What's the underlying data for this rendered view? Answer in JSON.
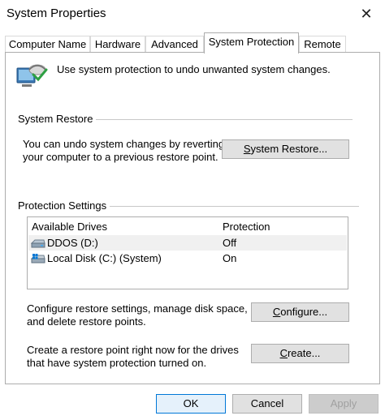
{
  "window": {
    "title": "System Properties",
    "close_glyph": "✕"
  },
  "tabs": [
    {
      "label": "Computer Name"
    },
    {
      "label": "Hardware"
    },
    {
      "label": "Advanced"
    },
    {
      "label": "System Protection"
    },
    {
      "label": "Remote"
    }
  ],
  "intro": {
    "text": "Use system protection to undo unwanted system changes."
  },
  "system_restore": {
    "title": "System Restore",
    "line1": "You can undo system changes by reverting",
    "line2": "your computer to a previous restore point.",
    "button_prefix": "S",
    "button_rest": "ystem Restore..."
  },
  "protection": {
    "title": "Protection Settings",
    "col_drives": "Available Drives",
    "col_protection": "Protection",
    "drives": [
      {
        "name": "DDOS (D:)",
        "status": "Off",
        "icon": "drive-icon"
      },
      {
        "name": "Local Disk (C:) (System)",
        "status": "On",
        "icon": "system-drive-icon"
      }
    ],
    "configure_line1": "Configure restore settings, manage disk space,",
    "configure_line2": "and delete restore points.",
    "configure_prefix": "C",
    "configure_rest": "onfigure...",
    "create_line1": "Create a restore point right now for the drives",
    "create_line2": "that have system protection turned on.",
    "create_prefix": "C",
    "create_rest": "reate..."
  },
  "footer": {
    "ok": "OK",
    "cancel": "Cancel",
    "apply": "Apply"
  }
}
